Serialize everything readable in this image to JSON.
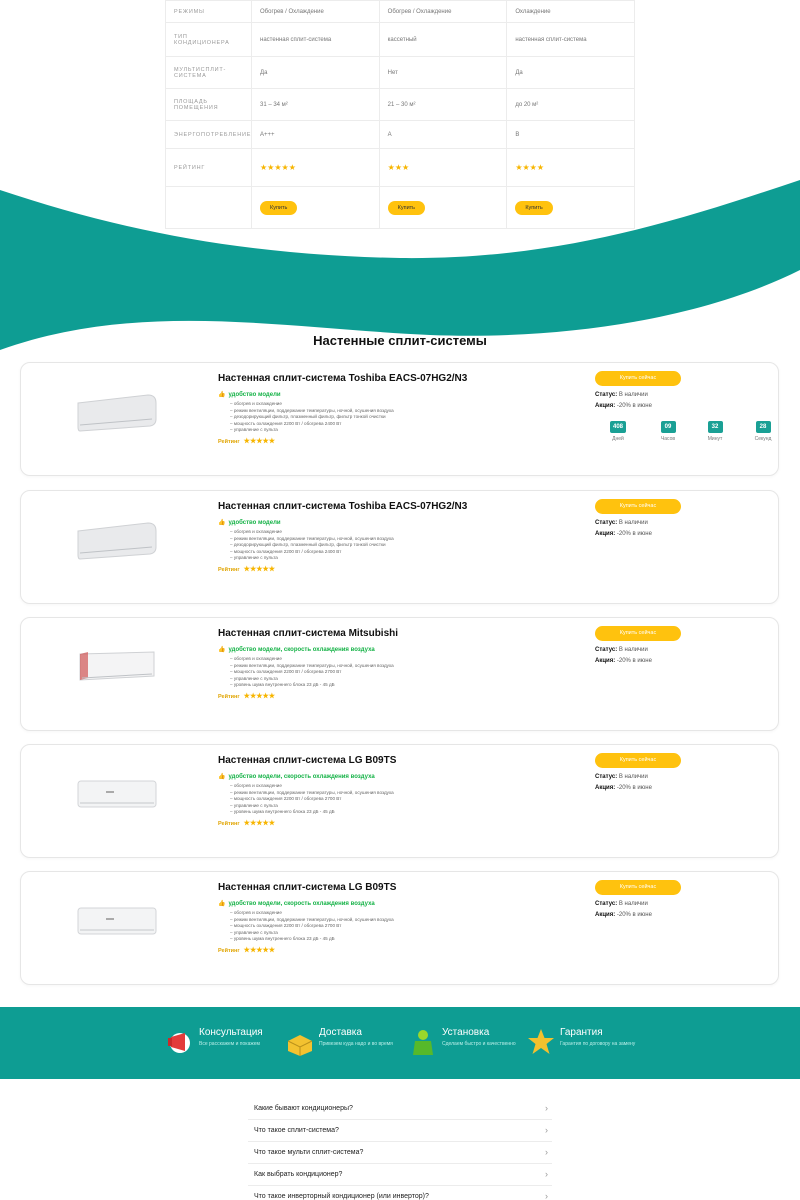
{
  "compare": {
    "rows": [
      {
        "label": "Режимы",
        "cells": [
          "Обогрев / Охлаждение",
          "Обогрев / Охлаждение",
          "Охлаждение"
        ]
      },
      {
        "label": "Тип кондиционера",
        "cells": [
          "настенная сплит-система",
          "кассетный",
          "настенная сплит-система"
        ]
      },
      {
        "label": "Мультисплит-система",
        "cells": [
          "Да",
          "Нет",
          "Да"
        ]
      },
      {
        "label": "Площадь помещения",
        "cells": [
          "31 – 34 м²",
          "21 – 30 м²",
          "до 20 м²"
        ]
      },
      {
        "label": "Энергопотребление",
        "cells": [
          "A+++",
          "A",
          "B"
        ]
      },
      {
        "label": "Рейтинг",
        "stars": [
          "★★★★★",
          "★★★",
          "★★★★"
        ]
      }
    ],
    "buy_label": "Купить"
  },
  "section_title": "Настенные сплит-системы",
  "products": [
    {
      "title": "Настенная сплит-система Toshiba EACS-07HG2/N3",
      "feature": "удобство модели",
      "specs": [
        "обогрев и охлаждение",
        "режим вентиляции, поддержание температуры, ночной, осушения воздуха",
        "дезодорирующий фильтр, плазменный фильтр, фильтр тонкой очистки",
        "мощность охлаждения 2200 Вт / обогрева 2400 Вт",
        "управление с пульта"
      ],
      "rating_label": "Рейтинг",
      "stars": "★★★★★",
      "buy_label": "Купить сейчас",
      "status_label": "Статус:",
      "status_value": "В наличии",
      "promo_label": "Акция:",
      "promo_value": "-20% в июне",
      "timer": [
        {
          "num": "408",
          "cap": "Дней"
        },
        {
          "num": "09",
          "cap": "Часов"
        },
        {
          "num": "32",
          "cap": "Минут"
        },
        {
          "num": "28",
          "cap": "Секунд"
        }
      ]
    },
    {
      "title": "Настенная сплит-система Toshiba EACS-07HG2/N3",
      "feature": "удобство модели",
      "specs": [
        "обогрев и охлаждение",
        "режим вентиляции, поддержание температуры, ночной, осушения воздуха",
        "дезодорирующий фильтр, плазменный фильтр, фильтр тонкой очистки",
        "мощность охлаждения 2200 Вт / обогрева 2400 Вт",
        "управление с пульта"
      ],
      "rating_label": "Рейтинг",
      "stars": "★★★★★",
      "buy_label": "Купить сейчас",
      "status_label": "Статус:",
      "status_value": "В наличии",
      "promo_label": "Акция:",
      "promo_value": "-20% в июне"
    },
    {
      "title": "Настенная сплит-система Mitsubishi",
      "feature": "удобство модели, скорость охлаждения воздуха",
      "specs": [
        "обогрев и охлаждение",
        "режим вентиляции, поддержание температуры, ночной, осушения воздуха",
        "мощность охлаждения 2200 Вт / обогрева 2700 Вт",
        "управление с пульта",
        "уровень шума внутреннего блока 23 дБ - 45 дБ"
      ],
      "rating_label": "Рейтинг",
      "stars": "★★★★★",
      "buy_label": "Купить сейчас",
      "status_label": "Статус:",
      "status_value": "В наличии",
      "promo_label": "Акция:",
      "promo_value": "-20% в июне"
    },
    {
      "title": "Настенная сплит-система LG B09TS",
      "feature": "удобство модели, скорость охлаждения воздуха",
      "specs": [
        "обогрев и охлаждение",
        "режим вентиляции, поддержание температуры, ночной, осушения воздуха",
        "мощность охлаждения 2200 Вт / обогрева 2700 Вт",
        "управление с пульта",
        "уровень шума внутреннего блока 23 дБ - 45 дБ"
      ],
      "rating_label": "Рейтинг",
      "stars": "★★★★★",
      "buy_label": "Купить сейчас",
      "status_label": "Статус:",
      "status_value": "В наличии",
      "promo_label": "Акция:",
      "promo_value": "-20% в июне"
    },
    {
      "title": "Настенная сплит-система LG B09TS",
      "feature": "удобство модели, скорость охлаждения воздуха",
      "specs": [
        "обогрев и охлаждение",
        "режим вентиляции, поддержание температуры, ночной, осушения воздуха",
        "мощность охлаждения 2200 Вт / обогрева 2700 Вт",
        "управление с пульта",
        "уровень шума внутреннего блока 23 дБ - 45 дБ"
      ],
      "rating_label": "Рейтинг",
      "stars": "★★★★★",
      "buy_label": "Купить сейчас",
      "status_label": "Статус:",
      "status_value": "В наличии",
      "promo_label": "Акция:",
      "promo_value": "-20% в июне"
    }
  ],
  "benefits": [
    {
      "title": "Консультация",
      "text": "Все расскажем и покажем",
      "icon": "megaphone-icon"
    },
    {
      "title": "Доставка",
      "text": "Привезем куда надо и во время",
      "icon": "box-icon"
    },
    {
      "title": "Установка",
      "text": "Сделаем быстро и качественно",
      "icon": "worker-icon"
    },
    {
      "title": "Гарантия",
      "text": "Гарантия по договору на замену",
      "icon": "star-ribbon-icon"
    }
  ],
  "faq": [
    "Какие бывают кондиционеры?",
    "Что такое сплит-система?",
    "Что такое мульти сплит-система?",
    "Как выбрать кондиционер?",
    "Что такое инверторный кондиционер (или инвертор)?"
  ],
  "colors": {
    "teal": "#0e9d93",
    "yellow": "#ffc20e",
    "green": "#14b246",
    "star": "#f7b500"
  }
}
